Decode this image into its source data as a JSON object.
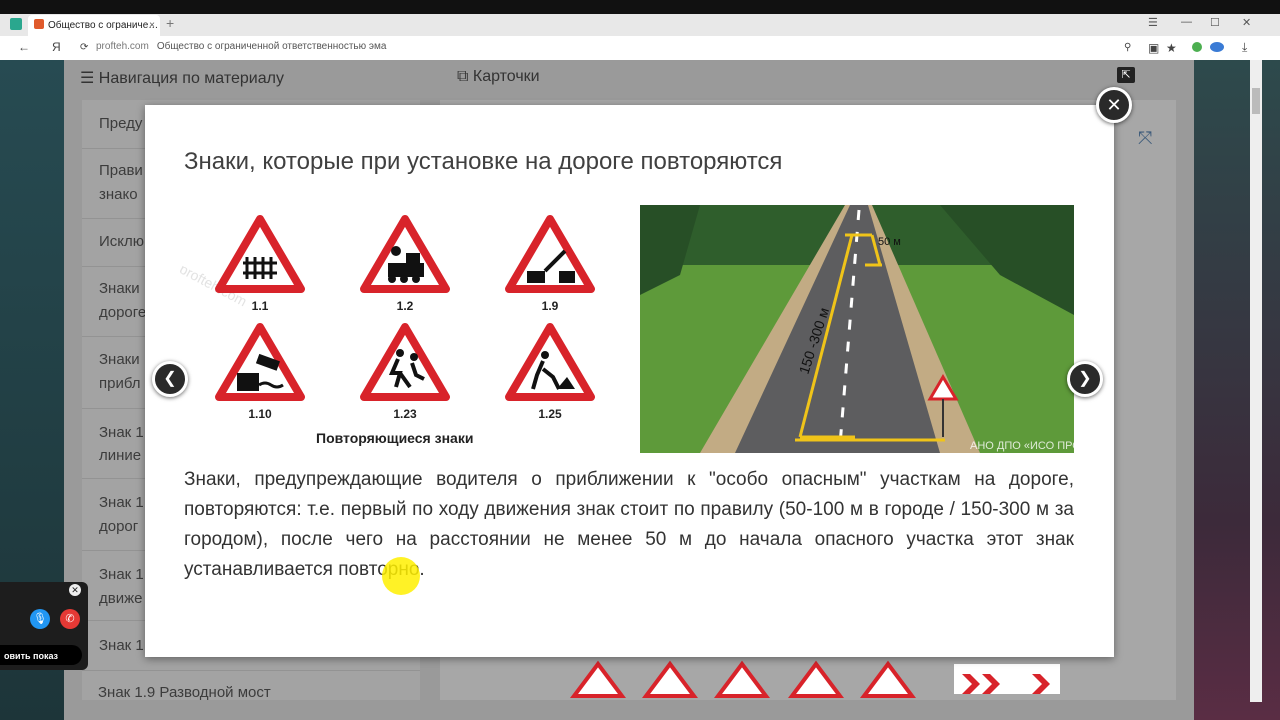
{
  "browser": {
    "tab_title": "Общество с ограниче…",
    "tab_close": "×",
    "new_tab": "+",
    "url_site": "profteh.com",
    "url_title": "Общество с ограниченной ответственностью эма",
    "yandex": "Я"
  },
  "header": {
    "nav_label": "Навигация по материалу",
    "cards_label": "Карточки"
  },
  "sidebar": {
    "items": [
      {
        "label": "Преду"
      },
      {
        "label": "Прави"
      },
      {
        "label": "знако"
      },
      {
        "label": "Исклю"
      },
      {
        "label": "Знаки"
      },
      {
        "label": "дороге"
      },
      {
        "label": "Знаки"
      },
      {
        "label": "прибл"
      },
      {
        "label": "Знак 1"
      },
      {
        "label": "линие"
      },
      {
        "label": "Знак 1"
      },
      {
        "label": "дорог"
      },
      {
        "label": "Знак 1"
      },
      {
        "label": "движе"
      },
      {
        "label": "Знак 1"
      }
    ],
    "last_item": "Знак 1.9 Разводной мост"
  },
  "modal": {
    "title": "Знаки, которые при установке на дороге повторяются",
    "signs": [
      {
        "label": "1.1",
        "icon": "railroad-crossing-sign"
      },
      {
        "label": "1.2",
        "icon": "train-sign"
      },
      {
        "label": "1.9",
        "icon": "drawbridge-sign"
      },
      {
        "label": "1.10",
        "icon": "embankment-sign"
      },
      {
        "label": "1.23",
        "icon": "children-sign"
      },
      {
        "label": "1.25",
        "icon": "road-works-sign"
      }
    ],
    "signs_caption": "Повторяющиеся знаки",
    "watermark": "profteh.com",
    "road_labels": {
      "distance_short": "50 м",
      "distance_long": "150 -300 м",
      "watermark": "АНО ДПО «ИСО ПРОФТЕХ»"
    },
    "body_text": "Знаки, предупреждающие водителя о приближении к \"особо опасным\" участкам на дороге, повторяются: т.е. первый по ходу движения знак стоит по правилу (50-100 м в городе / 150-300 м за городом), после чего  на расстоянии не менее 50 м до начала опасного участка этот знак устанавливается повторно.",
    "close_icon": "close-icon",
    "prev_icon": "chevron-left-icon",
    "next_icon": "chevron-right-icon"
  },
  "call_widget": {
    "label": "овить показ"
  },
  "colors": {
    "sign_red": "#d8232a",
    "grass": "#5e9a3a",
    "asphalt": "#5d5d5f",
    "highlight": "#fff000"
  }
}
